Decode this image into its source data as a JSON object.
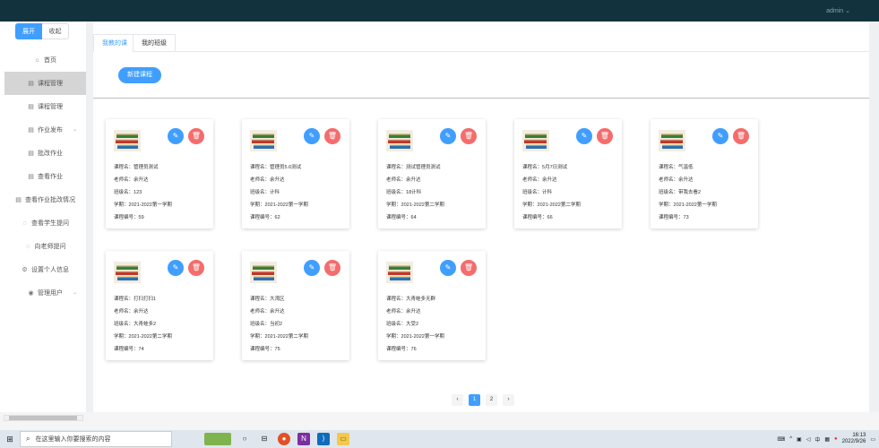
{
  "header": {
    "user": "admin ⌄"
  },
  "sidebar": {
    "expand_label": "展开",
    "collapse_label": "收起",
    "items": [
      {
        "label": "首页",
        "icon": "home-icon",
        "glyph": "⌂"
      },
      {
        "label": "课程管理",
        "icon": "document-icon",
        "glyph": "▤"
      },
      {
        "label": "课程管理",
        "icon": "document-icon",
        "glyph": "▤"
      },
      {
        "label": "作业发布",
        "icon": "document-icon",
        "glyph": "▤"
      },
      {
        "label": "批改作业",
        "icon": "document-icon",
        "glyph": "▤"
      },
      {
        "label": "查看作业",
        "icon": "document-icon",
        "glyph": "▤"
      },
      {
        "label": "查看作业批改情况",
        "icon": "document-icon",
        "glyph": "▤"
      },
      {
        "label": "查看学生提问",
        "icon": "chat-icon",
        "glyph": "◌"
      },
      {
        "label": "向老师提问",
        "icon": "chat-icon",
        "glyph": "◌"
      },
      {
        "label": "设置个人信息",
        "icon": "gear-icon",
        "glyph": "⚙"
      },
      {
        "label": "管理用户",
        "icon": "eye-icon",
        "glyph": "◉"
      }
    ]
  },
  "tabs": [
    "我教的课",
    "我的班级"
  ],
  "new_course_label": "新建课程",
  "field_labels": {
    "name": "课程名：",
    "teacher": "老师名：",
    "class": "班级名：",
    "term": "学期：",
    "id": "课程编号："
  },
  "courses": [
    {
      "name": "管理员测试",
      "teacher": "余升达",
      "class": "123",
      "term": "2021-2022第一学期",
      "id": "59"
    },
    {
      "name": "管理员5.6测试",
      "teacher": "余升达",
      "class": "计科",
      "term": "2021-2022第一学期",
      "id": "62"
    },
    {
      "name": "测试管理员测试",
      "teacher": "余升达",
      "class": "18计科",
      "term": "2021-2022第二学期",
      "id": "64"
    },
    {
      "name": "5月7日测试",
      "teacher": "余升达",
      "class": "计科",
      "term": "2021-2022第二学期",
      "id": "66"
    },
    {
      "name": "气温低",
      "teacher": "余升达",
      "class": "带我去看2",
      "term": "2021-2022第一学期",
      "id": "73"
    },
    {
      "name": "打扫打扫1",
      "teacher": "余升达",
      "class": "大青蛙多2",
      "term": "2021-2022第二学期",
      "id": "74"
    },
    {
      "name": "大湾区",
      "teacher": "余升达",
      "class": "当初2",
      "term": "2021-2022第二学期",
      "id": "75"
    },
    {
      "name": "大青蛙多无群",
      "teacher": "余升达",
      "class": "大受2",
      "term": "2021-2022第一学期",
      "id": "76"
    }
  ],
  "pagination": {
    "prev": "‹",
    "pages": [
      "1",
      "2"
    ],
    "current": "1",
    "next": "›"
  },
  "taskbar": {
    "search_placeholder": "在这里输入你要搜索的内容",
    "time": "16:13",
    "date": "2022/9/26",
    "ime_label": "中"
  },
  "colors": {
    "primary": "#409eff",
    "danger": "#f56c6c",
    "topbar": "#12333d"
  }
}
